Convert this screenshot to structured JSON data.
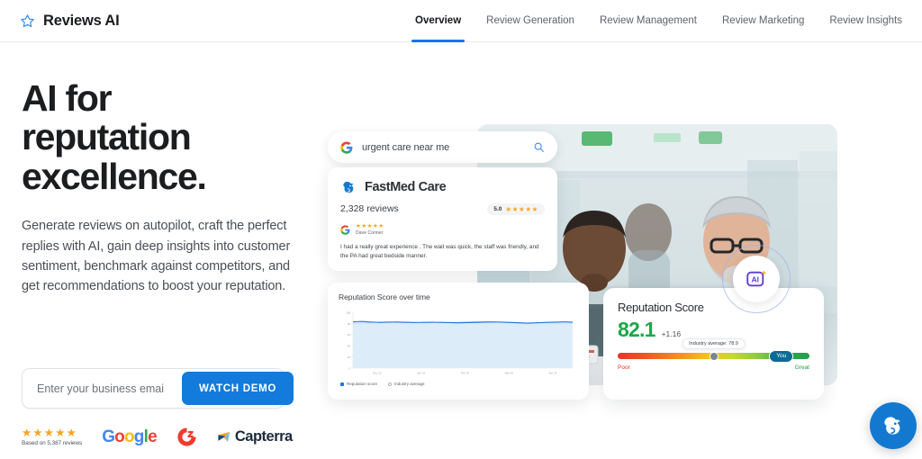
{
  "header": {
    "brand_name": "Reviews AI",
    "brand_icon": "star-outline-icon",
    "nav": [
      {
        "label": "Overview",
        "active": true
      },
      {
        "label": "Review Generation",
        "active": false
      },
      {
        "label": "Review Management",
        "active": false
      },
      {
        "label": "Review Marketing",
        "active": false
      },
      {
        "label": "Review Insights",
        "active": false
      }
    ]
  },
  "hero": {
    "title_line1": "AI for",
    "title_line2": "reputation",
    "title_line3": "excellence.",
    "subtitle": "Generate reviews on autopilot, craft the perfect replies with AI, gain deep insights into customer sentiment, benchmark against competitors, and get recommendations to boost your reputation.",
    "email_placeholder": "Enter your business emai",
    "email_value": "",
    "cta_label": "WATCH DEMO"
  },
  "social_proof": {
    "stars": "★★★★★",
    "caption": "Based on 5,387 reviews",
    "google": [
      "G",
      "o",
      "o",
      "g",
      "l",
      "e"
    ],
    "g2_label": "G2",
    "capterra_label": "Capterra"
  },
  "showcase": {
    "search": {
      "query": "urgent care near me",
      "engine_icon": "google-icon",
      "search_icon": "magnifier-icon"
    },
    "business": {
      "name": "FastMed Care",
      "logo_icon": "fastmed-bird-icon",
      "reviews_count": "2,328 reviews",
      "rating_value": "5.0",
      "rating_stars": "★★★★★",
      "review": {
        "source_icon": "google-icon",
        "stars": "★★★★★",
        "author": "Dave Conner",
        "text": "I had a really great experience . The wait was quick, the staff was friendly, and the PA had great bedside manner."
      }
    },
    "score_panel": {
      "title": "Reputation Score",
      "value": "82.1",
      "delta": "+1.16",
      "tooltip": "Industry average: 78.9",
      "marker_label": "You",
      "scale_low": "Poor",
      "scale_high": "Great",
      "value_color": "#19a84a"
    },
    "ai_badge": {
      "label": "AI",
      "icon": "ai-sparkle-icon",
      "color": "#5b3fd6"
    },
    "photo_alt": "two-doctors-reviewing-tablet-in-hospital-corridor"
  },
  "chat_widget": {
    "icon": "chat-bird-icon",
    "color": "#1379d0"
  },
  "chart_data": {
    "type": "area",
    "title": "Reputation Score over time",
    "xlabel": "",
    "ylabel": "",
    "ylim": [
      0,
      100
    ],
    "yticks": [
      0,
      20,
      40,
      60,
      80,
      100
    ],
    "grid": false,
    "legend_position": "bottom-left",
    "categories": [
      "Dec '23",
      "Jan '24",
      "Feb '24",
      "Mar '24",
      "Apr '24"
    ],
    "x": [
      0,
      4,
      8,
      12,
      16,
      20,
      24,
      28,
      32,
      36,
      40,
      44,
      48,
      52,
      56,
      60,
      64,
      68,
      72,
      76,
      80,
      84,
      88,
      92,
      96,
      100
    ],
    "series": [
      {
        "name": "Reputation score",
        "color": "#1a73e8",
        "fill": "#d6e8f8",
        "values": [
          83,
          83.5,
          82.5,
          82,
          82.3,
          82.6,
          82.2,
          81.8,
          81.9,
          82.1,
          82,
          81.5,
          81.2,
          81.6,
          82,
          82.4,
          82.6,
          82.3,
          81.7,
          80.9,
          80.6,
          81.2,
          81.9,
          82.4,
          82.8,
          82.4
        ]
      },
      {
        "name": "Industry average",
        "color": "#b9bfc6",
        "fill": "none",
        "values": [
          79.4,
          80.2,
          81,
          81.4,
          81.5,
          81.3,
          81.2,
          81.4,
          81.6,
          81.5,
          81.3,
          81.6,
          82.2,
          82.8,
          83.1,
          83.2,
          82.9,
          82.4,
          81.9,
          81.4,
          81,
          80.8,
          80.6,
          80.2,
          79.6,
          79.1
        ]
      }
    ]
  }
}
